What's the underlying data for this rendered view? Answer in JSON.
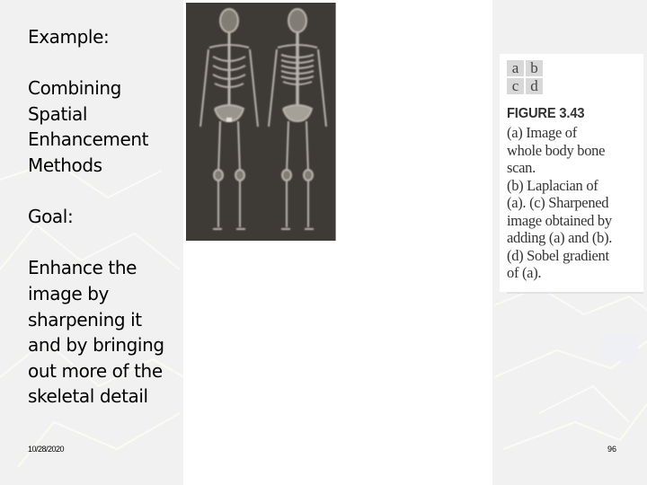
{
  "slide": {
    "left_text": {
      "example_heading": "Example:",
      "example_body": "Combining\nSpatial\nEnhancement\nMethods",
      "goal_heading": "Goal:",
      "goal_body": "Enhance the\nimage by\nsharpening it\nand by bringing\nout more of the\nskeletal detail"
    },
    "figure": {
      "image_description": "Whole body bone scan (anterior and posterior skeleton views)",
      "panel_key": [
        "a",
        "b",
        "c",
        "d"
      ],
      "title": "FIGURE 3.43",
      "caption": "(a) Image of\nwhole body bone\nscan.\n(b) Laplacian of\n(a). (c) Sharpened\nimage obtained by\nadding (a) and (b).\n(d) Sobel gradient\nof (a)."
    },
    "footer": {
      "date": "10/28/2020",
      "page_number": "96"
    },
    "colors": {
      "background": "#f1f1f1",
      "panel": "#ffffff",
      "scan_background": "#3e3a35",
      "text": "#000000",
      "caption_text": "#333333"
    }
  }
}
